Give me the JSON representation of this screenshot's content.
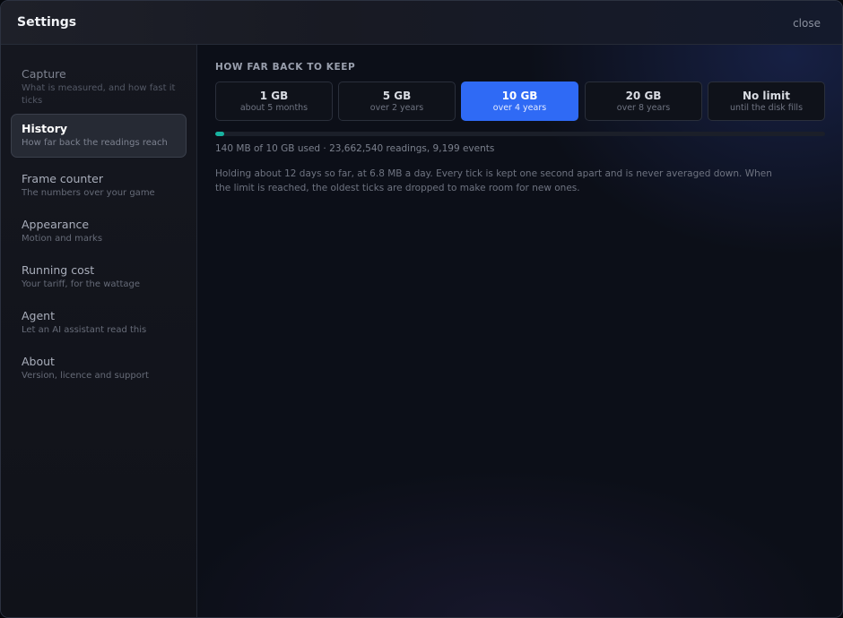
{
  "window": {
    "title": "Settings",
    "close_label": "close"
  },
  "sidebar": {
    "items": [
      {
        "label": "Capture",
        "sub": "What is measured, and how fast it ticks",
        "active": false,
        "dim": true
      },
      {
        "label": "History",
        "sub": "How far back the readings reach",
        "active": true,
        "dim": false
      },
      {
        "label": "Frame counter",
        "sub": "The numbers over your game",
        "active": false,
        "dim": false
      },
      {
        "label": "Appearance",
        "sub": "Motion and marks",
        "active": false,
        "dim": false
      },
      {
        "label": "Running cost",
        "sub": "Your tariff, for the wattage",
        "active": false,
        "dim": false
      },
      {
        "label": "Agent",
        "sub": "Let an AI assistant read this",
        "active": false,
        "dim": false
      },
      {
        "label": "About",
        "sub": "Version, licence and support",
        "active": false,
        "dim": false
      }
    ]
  },
  "history": {
    "heading": "HOW FAR BACK TO KEEP",
    "options": [
      {
        "label": "1 GB",
        "sub": "about 5 months",
        "selected": false
      },
      {
        "label": "5 GB",
        "sub": "over 2 years",
        "selected": false
      },
      {
        "label": "10 GB",
        "sub": "over 4 years",
        "selected": true
      },
      {
        "label": "20 GB",
        "sub": "over 8 years",
        "selected": false
      },
      {
        "label": "No limit",
        "sub": "until the disk fills",
        "selected": false
      }
    ],
    "usage_fraction": 0.014,
    "usage_text": "140 MB of 10 GB used ·  23,662,540 readings, 9,199 events",
    "description": "Holding about 12 days so far, at 6.8 MB a day. Every tick is kept one second apart and is never averaged down. When the limit is reached, the oldest ticks are dropped to make room for new ones."
  },
  "colors": {
    "accent": "#2f6af5",
    "usage_bar": "#18b3a0"
  }
}
